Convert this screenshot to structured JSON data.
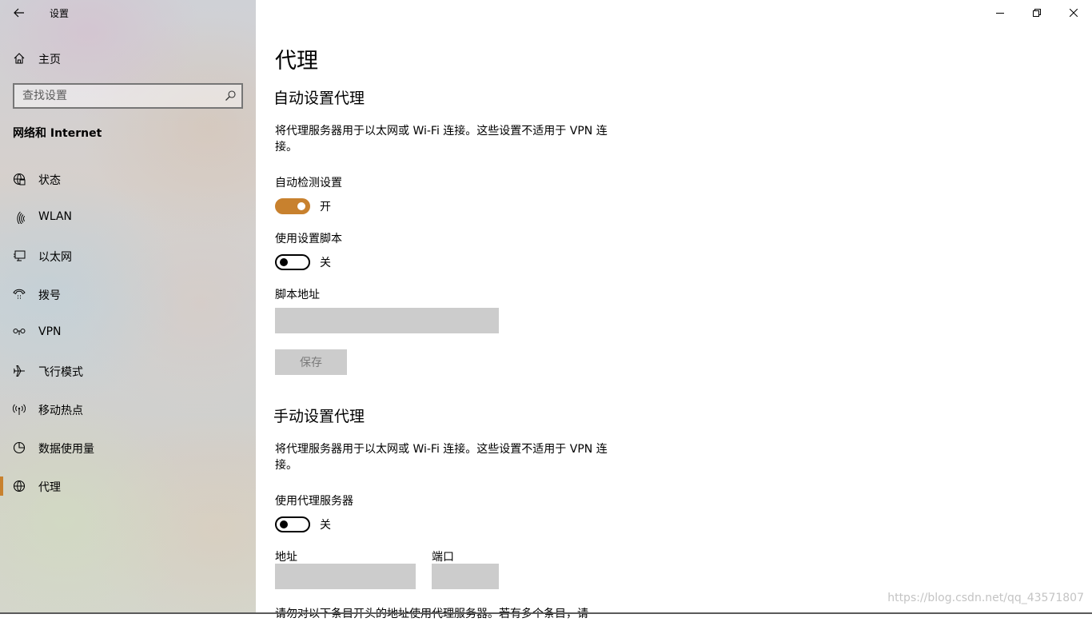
{
  "window": {
    "app_title": "设置",
    "controls": [
      "minimize",
      "restore",
      "close"
    ]
  },
  "sidebar": {
    "home_label": "主页",
    "search_placeholder": "查找设置",
    "section_title": "网络和 Internet",
    "items": [
      {
        "label": "状态",
        "icon": "globe-status-icon"
      },
      {
        "label": "WLAN",
        "icon": "wifi-icon"
      },
      {
        "label": "以太网",
        "icon": "ethernet-icon"
      },
      {
        "label": "拨号",
        "icon": "dialup-icon"
      },
      {
        "label": "VPN",
        "icon": "vpn-icon"
      },
      {
        "label": "飞行模式",
        "icon": "airplane-icon"
      },
      {
        "label": "移动热点",
        "icon": "hotspot-icon"
      },
      {
        "label": "数据使用量",
        "icon": "data-usage-icon"
      },
      {
        "label": "代理",
        "icon": "globe-icon",
        "active": true
      }
    ]
  },
  "main": {
    "page_title": "代理",
    "auto": {
      "heading": "自动设置代理",
      "desc_line1": "将代理服务器用于以太网或 Wi-Fi 连接。这些设置不适用于 VPN 连",
      "desc_line2": "接。",
      "detect_label": "自动检测设置",
      "detect_state": "开",
      "script_label": "使用设置脚本",
      "script_state": "关",
      "address_label": "脚本地址",
      "address_value": "",
      "save_label": "保存"
    },
    "manual": {
      "heading": "手动设置代理",
      "desc_line1": "将代理服务器用于以太网或 Wi-Fi 连接。这些设置不适用于 VPN 连",
      "desc_line2": "接。",
      "use_proxy_label": "使用代理服务器",
      "use_proxy_state": "关",
      "address_label": "地址",
      "address_value": "",
      "port_label": "端口",
      "port_value": "",
      "cut_text": "请勿对以下条目开头的地址使用代理服务器。若有多个条目，请"
    },
    "watermark": "https://blog.csdn.net/qq_43571807"
  },
  "colors": {
    "accent": "#c8812e",
    "textbox_bg": "#cccccc"
  }
}
